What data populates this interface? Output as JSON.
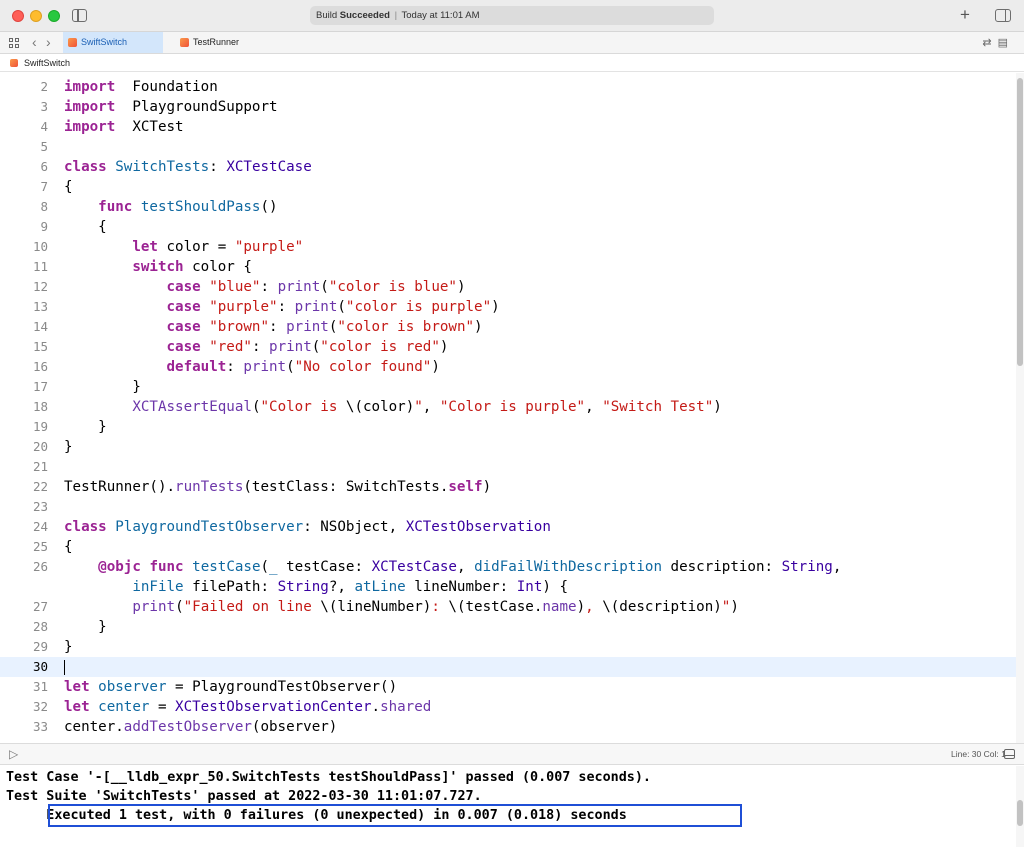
{
  "window": {
    "status_prefix": "Build",
    "status_bold": "Succeeded",
    "status_sep": "|",
    "status_time": "Today at 11:01 AM"
  },
  "tabs": [
    {
      "label": "SwiftSwitch",
      "active": true
    },
    {
      "label": "TestRunner",
      "active": false
    }
  ],
  "breadcrumb": {
    "file": "SwiftSwitch"
  },
  "editor": {
    "current_line": "30",
    "lines": [
      {
        "n": "2",
        "seg": [
          [
            "kw",
            "import"
          ],
          [
            "",
            "  Foundation"
          ]
        ]
      },
      {
        "n": "3",
        "seg": [
          [
            "kw",
            "import"
          ],
          [
            "",
            "  PlaygroundSupport"
          ]
        ]
      },
      {
        "n": "4",
        "seg": [
          [
            "kw",
            "import"
          ],
          [
            "",
            "  XCTest"
          ]
        ]
      },
      {
        "n": "5",
        "seg": []
      },
      {
        "n": "6",
        "seg": [
          [
            "kw",
            "class"
          ],
          [
            "",
            " "
          ],
          [
            "decl",
            "SwitchTests"
          ],
          [
            "",
            ": "
          ],
          [
            "type",
            "XCTestCase"
          ]
        ]
      },
      {
        "n": "7",
        "seg": [
          [
            "",
            "{"
          ]
        ]
      },
      {
        "n": "8",
        "seg": [
          [
            "",
            "    "
          ],
          [
            "kw",
            "func"
          ],
          [
            "",
            " "
          ],
          [
            "decl",
            "testShouldPass"
          ],
          [
            "",
            "()"
          ]
        ]
      },
      {
        "n": "9",
        "seg": [
          [
            "",
            "    {"
          ]
        ]
      },
      {
        "n": "10",
        "seg": [
          [
            "",
            "        "
          ],
          [
            "kw",
            "let"
          ],
          [
            "",
            " color = "
          ],
          [
            "str",
            "\"purple\""
          ]
        ]
      },
      {
        "n": "11",
        "seg": [
          [
            "",
            "        "
          ],
          [
            "kw",
            "switch"
          ],
          [
            "",
            " color {"
          ]
        ]
      },
      {
        "n": "12",
        "seg": [
          [
            "",
            "            "
          ],
          [
            "kw",
            "case"
          ],
          [
            "",
            " "
          ],
          [
            "str",
            "\"blue\""
          ],
          [
            "",
            ": "
          ],
          [
            "func",
            "print"
          ],
          [
            "",
            "("
          ],
          [
            "str",
            "\"color is blue\""
          ],
          [
            "",
            ")"
          ]
        ]
      },
      {
        "n": "13",
        "seg": [
          [
            "",
            "            "
          ],
          [
            "kw",
            "case"
          ],
          [
            "",
            " "
          ],
          [
            "str",
            "\"purple\""
          ],
          [
            "",
            ": "
          ],
          [
            "func",
            "print"
          ],
          [
            "",
            "("
          ],
          [
            "str",
            "\"color is purple\""
          ],
          [
            "",
            ")"
          ]
        ]
      },
      {
        "n": "14",
        "seg": [
          [
            "",
            "            "
          ],
          [
            "kw",
            "case"
          ],
          [
            "",
            " "
          ],
          [
            "str",
            "\"brown\""
          ],
          [
            "",
            ": "
          ],
          [
            "func",
            "print"
          ],
          [
            "",
            "("
          ],
          [
            "str",
            "\"color is brown\""
          ],
          [
            "",
            ")"
          ]
        ]
      },
      {
        "n": "15",
        "seg": [
          [
            "",
            "            "
          ],
          [
            "kw",
            "case"
          ],
          [
            "",
            " "
          ],
          [
            "str",
            "\"red\""
          ],
          [
            "",
            ": "
          ],
          [
            "func",
            "print"
          ],
          [
            "",
            "("
          ],
          [
            "str",
            "\"color is red\""
          ],
          [
            "",
            ")"
          ]
        ]
      },
      {
        "n": "16",
        "seg": [
          [
            "",
            "            "
          ],
          [
            "kw",
            "default"
          ],
          [
            "",
            ": "
          ],
          [
            "func",
            "print"
          ],
          [
            "",
            "("
          ],
          [
            "str",
            "\"No color found\""
          ],
          [
            "",
            ")"
          ]
        ]
      },
      {
        "n": "17",
        "seg": [
          [
            "",
            "        }"
          ]
        ]
      },
      {
        "n": "18",
        "seg": [
          [
            "",
            "        "
          ],
          [
            "func",
            "XCTAssertEqual"
          ],
          [
            "",
            "("
          ],
          [
            "str",
            "\"Color is "
          ],
          [
            "",
            "\\(color)"
          ],
          [
            "str",
            "\""
          ],
          [
            "",
            ", "
          ],
          [
            "str",
            "\"Color is purple\""
          ],
          [
            "",
            ", "
          ],
          [
            "str",
            "\"Switch Test\""
          ],
          [
            "",
            ")"
          ]
        ]
      },
      {
        "n": "19",
        "seg": [
          [
            "",
            "    }"
          ]
        ]
      },
      {
        "n": "20",
        "seg": [
          [
            "",
            "}"
          ]
        ]
      },
      {
        "n": "21",
        "seg": []
      },
      {
        "n": "22",
        "seg": [
          [
            "",
            "TestRunner()."
          ],
          [
            "func",
            "runTests"
          ],
          [
            "",
            "(testClass: SwitchTests."
          ],
          [
            "kw",
            "self"
          ],
          [
            "",
            ")"
          ]
        ]
      },
      {
        "n": "23",
        "seg": []
      },
      {
        "n": "24",
        "seg": [
          [
            "kw",
            "class"
          ],
          [
            "",
            " "
          ],
          [
            "decl",
            "PlaygroundTestObserver"
          ],
          [
            "",
            ": NSObject, "
          ],
          [
            "type",
            "XCTestObservation"
          ]
        ]
      },
      {
        "n": "25",
        "seg": [
          [
            "",
            "{"
          ]
        ]
      },
      {
        "n": "26",
        "seg": [
          [
            "",
            "    "
          ],
          [
            "kw",
            "@objc"
          ],
          [
            "",
            " "
          ],
          [
            "kw",
            "func"
          ],
          [
            "",
            " "
          ],
          [
            "decl",
            "testCase"
          ],
          [
            "",
            "("
          ],
          [
            "decl",
            "_"
          ],
          [
            "",
            " testCase: "
          ],
          [
            "type",
            "XCTestCase"
          ],
          [
            "",
            ", "
          ],
          [
            "decl",
            "didFailWithDescription"
          ],
          [
            "",
            " description: "
          ],
          [
            "type",
            "String"
          ],
          [
            "",
            ","
          ]
        ]
      },
      {
        "n": "",
        "seg": [
          [
            "",
            "        "
          ],
          [
            "decl",
            "inFile"
          ],
          [
            "",
            " filePath: "
          ],
          [
            "type",
            "String"
          ],
          [
            "",
            "?, "
          ],
          [
            "decl",
            "atLine"
          ],
          [
            "",
            " lineNumber: "
          ],
          [
            "type",
            "Int"
          ],
          [
            "",
            ") {"
          ]
        ]
      },
      {
        "n": "27",
        "seg": [
          [
            "",
            "        "
          ],
          [
            "func",
            "print"
          ],
          [
            "",
            "("
          ],
          [
            "str",
            "\"Failed on line "
          ],
          [
            "",
            "\\(lineNumber)"
          ],
          [
            "str",
            ": "
          ],
          [
            "",
            "\\(testCase."
          ],
          [
            "func",
            "name"
          ],
          [
            "",
            ")"
          ],
          [
            "str",
            ", "
          ],
          [
            "",
            "\\(description)"
          ],
          [
            "str",
            "\""
          ],
          [
            "",
            ")"
          ]
        ]
      },
      {
        "n": "28",
        "seg": [
          [
            "",
            "    }"
          ]
        ]
      },
      {
        "n": "29",
        "seg": [
          [
            "",
            "}"
          ]
        ]
      },
      {
        "n": "30",
        "seg": []
      },
      {
        "n": "31",
        "seg": [
          [
            "kw",
            "let"
          ],
          [
            "",
            " "
          ],
          [
            "decl",
            "observer"
          ],
          [
            "",
            " = PlaygroundTestObserver()"
          ]
        ]
      },
      {
        "n": "32",
        "seg": [
          [
            "kw",
            "let"
          ],
          [
            "",
            " "
          ],
          [
            "decl",
            "center"
          ],
          [
            "",
            " = "
          ],
          [
            "type",
            "XCTestObservationCenter"
          ],
          [
            "",
            "."
          ],
          [
            "func",
            "shared"
          ]
        ]
      },
      {
        "n": "33",
        "seg": [
          [
            "",
            "center."
          ],
          [
            "func",
            "addTestObserver"
          ],
          [
            "",
            "(observer)"
          ]
        ]
      }
    ]
  },
  "status_strip": {
    "line_col": "Line: 30  Col: 1"
  },
  "console": {
    "lines": [
      "Test Case '-[__lldb_expr_50.SwitchTests testShouldPass]' passed (0.007 seconds).",
      "Test Suite 'SwitchTests' passed at 2022-03-30 11:01:07.727.",
      "     Executed 1 test, with 0 failures (0 unexpected) in 0.007 (0.018) seconds"
    ]
  },
  "colors": {
    "keyword": "#9b2393",
    "type": "#3900a0",
    "declaration": "#0f68a0",
    "function": "#6c36a9",
    "string": "#c41a16",
    "highlight_box": "#1f4fd6"
  }
}
